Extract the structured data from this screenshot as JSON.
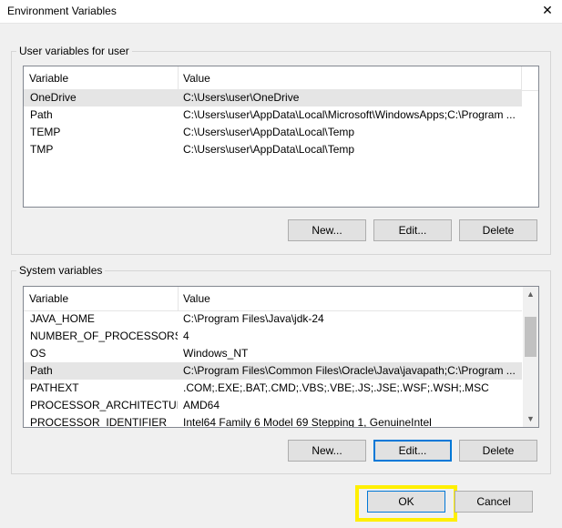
{
  "window": {
    "title": "Environment Variables",
    "close_glyph": "✕"
  },
  "user_group": {
    "label": "User variables for user",
    "columns": {
      "variable": "Variable",
      "value": "Value"
    },
    "rows": [
      {
        "variable": "OneDrive",
        "value": "C:\\Users\\user\\OneDrive",
        "selected": true
      },
      {
        "variable": "Path",
        "value": "C:\\Users\\user\\AppData\\Local\\Microsoft\\WindowsApps;C:\\Program ..."
      },
      {
        "variable": "TEMP",
        "value": "C:\\Users\\user\\AppData\\Local\\Temp"
      },
      {
        "variable": "TMP",
        "value": "C:\\Users\\user\\AppData\\Local\\Temp"
      }
    ],
    "buttons": {
      "new": "New...",
      "edit": "Edit...",
      "delete": "Delete"
    }
  },
  "system_group": {
    "label": "System variables",
    "columns": {
      "variable": "Variable",
      "value": "Value"
    },
    "rows": [
      {
        "variable": "JAVA_HOME",
        "value": "C:\\Program Files\\Java\\jdk-24"
      },
      {
        "variable": "NUMBER_OF_PROCESSORS",
        "value": "4"
      },
      {
        "variable": "OS",
        "value": "Windows_NT"
      },
      {
        "variable": "Path",
        "value": "C:\\Program Files\\Common Files\\Oracle\\Java\\javapath;C:\\Program ...",
        "selected": true
      },
      {
        "variable": "PATHEXT",
        "value": ".COM;.EXE;.BAT;.CMD;.VBS;.VBE;.JS;.JSE;.WSF;.WSH;.MSC"
      },
      {
        "variable": "PROCESSOR_ARCHITECTURE",
        "value": "AMD64"
      },
      {
        "variable": "PROCESSOR_IDENTIFIER",
        "value": "Intel64 Family 6 Model 69 Stepping 1, GenuineIntel"
      }
    ],
    "buttons": {
      "new": "New...",
      "edit": "Edit...",
      "delete": "Delete"
    }
  },
  "dialog_buttons": {
    "ok": "OK",
    "cancel": "Cancel"
  },
  "colors": {
    "selection": "#e5e5e5",
    "focus": "#0078d7",
    "highlight": "#ffef00"
  }
}
